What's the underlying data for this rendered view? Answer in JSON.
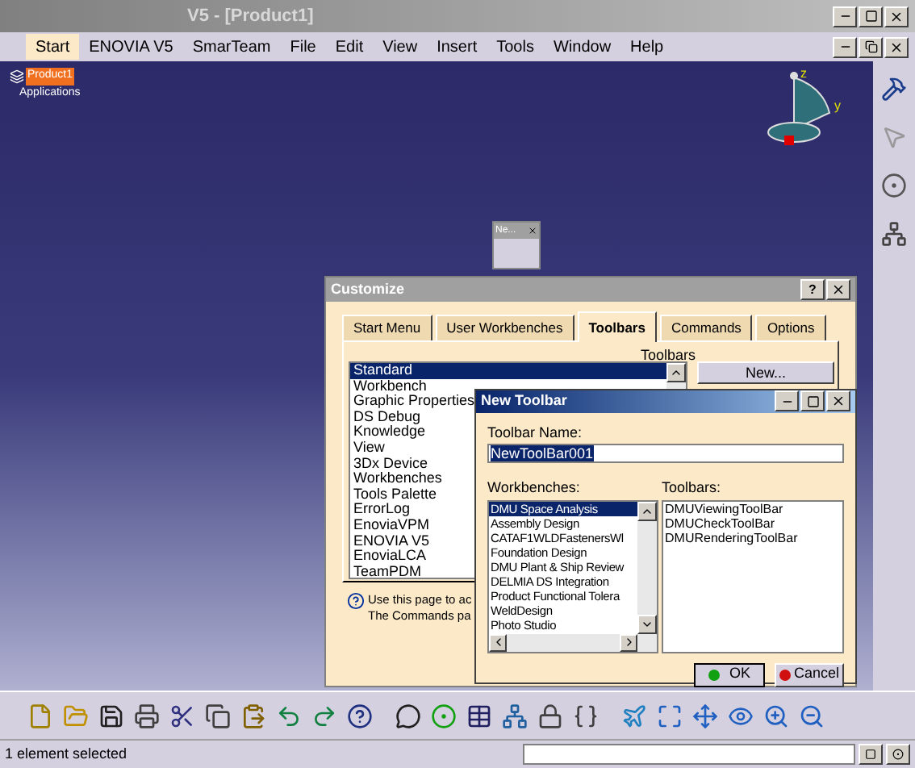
{
  "window": {
    "title": "V5 - [Product1]"
  },
  "menu": [
    {
      "label": "Start",
      "selected": true
    },
    {
      "label": "ENOVIA V5",
      "selected": false
    },
    {
      "label": "SmarTeam",
      "selected": false
    },
    {
      "label": "File",
      "selected": false
    },
    {
      "label": "Edit",
      "selected": false
    },
    {
      "label": "View",
      "selected": false
    },
    {
      "label": "Insert",
      "selected": false
    },
    {
      "label": "Tools",
      "selected": false
    },
    {
      "label": "Window",
      "selected": false
    },
    {
      "label": "Help",
      "selected": false
    }
  ],
  "tree": {
    "label": "Product1",
    "children": [
      {
        "label": "Applications"
      }
    ]
  },
  "compass": {
    "axis_labels": [
      "z",
      "y"
    ]
  },
  "floating_toolbar": {
    "title": "Ne..."
  },
  "customize": {
    "title": "Customize",
    "help_button": "?",
    "tabs": [
      {
        "label": "Start Menu",
        "selected": false
      },
      {
        "label": "User Workbenches",
        "selected": false
      },
      {
        "label": "Toolbars",
        "selected": true
      },
      {
        "label": "Commands",
        "selected": false
      },
      {
        "label": "Options",
        "selected": false
      }
    ],
    "toolbars_label": "Toolbars",
    "toolbars": [
      {
        "label": "Standard",
        "selected": true
      },
      {
        "label": "Workbench",
        "selected": false
      },
      {
        "label": "Graphic Properties",
        "selected": false
      },
      {
        "label": "DS Debug",
        "selected": false
      },
      {
        "label": "Knowledge",
        "selected": false
      },
      {
        "label": "View",
        "selected": false
      },
      {
        "label": "3Dx Device",
        "selected": false
      },
      {
        "label": "Workbenches",
        "selected": false
      },
      {
        "label": "Tools Palette",
        "selected": false
      },
      {
        "label": "ErrorLog",
        "selected": false
      },
      {
        "label": "EnoviaVPM",
        "selected": false
      },
      {
        "label": "ENOVIA V5",
        "selected": false
      },
      {
        "label": "EnoviaLCA",
        "selected": false
      },
      {
        "label": "TeamPDM",
        "selected": false
      }
    ],
    "new_button": "New...",
    "help_lines": [
      "Use this page to ac",
      "The Commands pa"
    ]
  },
  "new_toolbar": {
    "title": "New Toolbar",
    "name_label": "Toolbar Name:",
    "name_value": "NewToolBar001",
    "workbenches_label": "Workbenches:",
    "workbenches": [
      {
        "label": "DMU Space Analysis",
        "selected": true
      },
      {
        "label": "Assembly Design",
        "selected": false
      },
      {
        "label": "CATAF1WLDFastenersWl",
        "selected": false
      },
      {
        "label": "Foundation Design",
        "selected": false
      },
      {
        "label": "DMU Plant & Ship Review",
        "selected": false
      },
      {
        "label": "DELMIA DS Integration",
        "selected": false
      },
      {
        "label": "Product Functional Tolera",
        "selected": false
      },
      {
        "label": "WeldDesign",
        "selected": false
      },
      {
        "label": "Photo Studio",
        "selected": false
      }
    ],
    "toolbars_label": "Toolbars:",
    "toolbars": [
      "DMUViewingToolBar",
      "DMUCheckToolBar",
      "DMURenderingToolBar"
    ],
    "ok": "OK",
    "cancel": "Cancel"
  },
  "status_bar": {
    "message": "1 element selected"
  }
}
